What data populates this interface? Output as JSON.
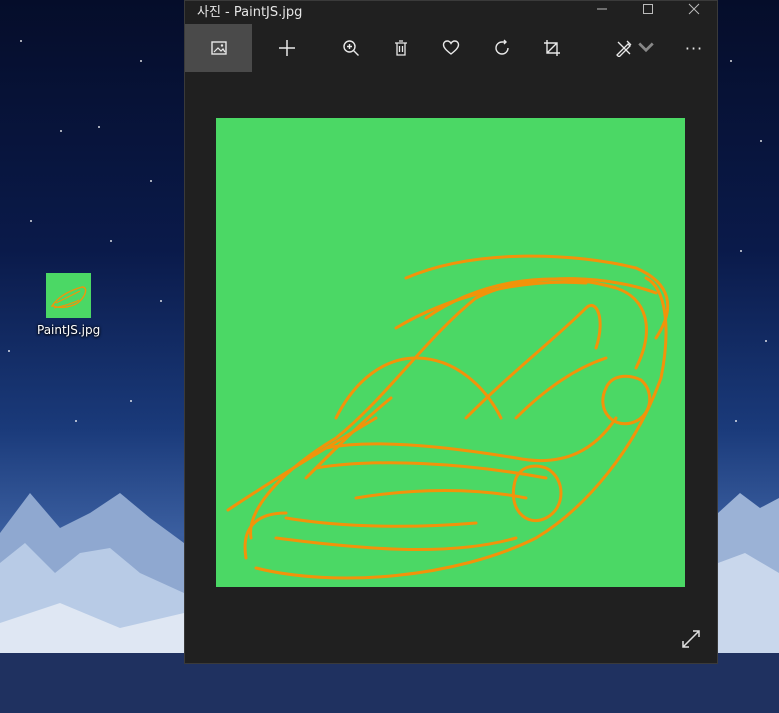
{
  "desktop": {
    "icon_label": "PaintJS.jpg"
  },
  "window": {
    "title": "사진 - PaintJS.jpg",
    "controls": [
      "minimize-icon",
      "maximize-icon",
      "close-icon"
    ]
  },
  "toolbar": {
    "items": [
      {
        "name": "image-icon",
        "active": true
      },
      {
        "name": "add-icon"
      },
      {
        "name": "zoom-icon"
      },
      {
        "name": "delete-icon"
      },
      {
        "name": "favorite-icon"
      },
      {
        "name": "rotate-icon"
      },
      {
        "name": "crop-icon"
      },
      {
        "name": "edit-draw-icon"
      },
      {
        "name": "more-icon"
      }
    ],
    "more_label": "···"
  },
  "image": {
    "background": "#4bd865",
    "stroke": "#f2930a"
  },
  "colors": {
    "window_bg": "#202020",
    "toolbar_active": "#4a4a4a"
  }
}
